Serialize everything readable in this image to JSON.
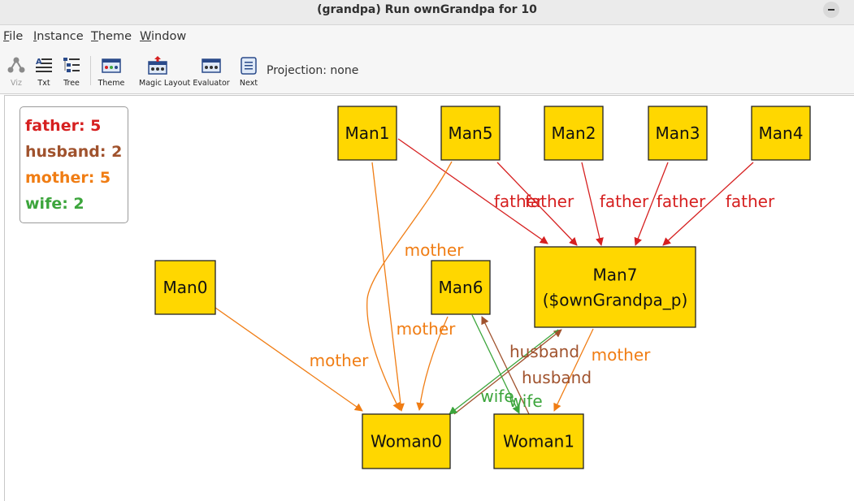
{
  "window": {
    "title": "(grandpa) Run ownGrandpa for 10"
  },
  "menu": [
    {
      "mnemonic": "F",
      "rest": "ile"
    },
    {
      "mnemonic": "I",
      "rest": "nstance"
    },
    {
      "mnemonic": "T",
      "rest": "heme"
    },
    {
      "mnemonic": "W",
      "rest": "indow"
    }
  ],
  "toolbar": {
    "viz": "Viz",
    "txt": "Txt",
    "tree": "Tree",
    "theme": "Theme",
    "magic_layout": "Magic Layout",
    "evaluator": "Evaluator",
    "next": "Next",
    "projection": "Projection: none"
  },
  "legend": [
    {
      "text": "father: 5",
      "color": "#d62020"
    },
    {
      "text": "husband: 2",
      "color": "#a0522d"
    },
    {
      "text": "mother: 5",
      "color": "#f07d14"
    },
    {
      "text": "wife: 2",
      "color": "#3ca53c"
    }
  ],
  "colors": {
    "node_fill": "#ffd700",
    "node_border": "#222222"
  },
  "graph": {
    "nodes": [
      {
        "id": "Man1",
        "label": "Man1"
      },
      {
        "id": "Man5",
        "label": "Man5"
      },
      {
        "id": "Man2",
        "label": "Man2"
      },
      {
        "id": "Man3",
        "label": "Man3"
      },
      {
        "id": "Man4",
        "label": "Man4"
      },
      {
        "id": "Man0",
        "label": "Man0"
      },
      {
        "id": "Man6",
        "label": "Man6"
      },
      {
        "id": "Man7",
        "label": "Man7",
        "sublabel": "($ownGrandpa_p)"
      },
      {
        "id": "Woman0",
        "label": "Woman0"
      },
      {
        "id": "Woman1",
        "label": "Woman1"
      }
    ],
    "edges": [
      {
        "from": "Man1",
        "to": "Man7",
        "label": "father",
        "relation": "father"
      },
      {
        "from": "Man5",
        "to": "Man7",
        "label": "father",
        "relation": "father"
      },
      {
        "from": "Man2",
        "to": "Man7",
        "label": "father",
        "relation": "father"
      },
      {
        "from": "Man3",
        "to": "Man7",
        "label": "father",
        "relation": "father"
      },
      {
        "from": "Man4",
        "to": "Man7",
        "label": "father",
        "relation": "father"
      },
      {
        "from": "Man1",
        "to": "Woman0",
        "label": "",
        "relation": "mother"
      },
      {
        "from": "Man5",
        "to": "Woman0",
        "label": "mother",
        "relation": "mother"
      },
      {
        "from": "Man0",
        "to": "Woman0",
        "label": "mother",
        "relation": "mother"
      },
      {
        "from": "Man6",
        "to": "Woman0",
        "label": "mother",
        "relation": "mother"
      },
      {
        "from": "Man7",
        "to": "Woman1",
        "label": "mother",
        "relation": "mother"
      },
      {
        "from": "Woman0",
        "to": "Man7",
        "label": "husband",
        "relation": "husband"
      },
      {
        "from": "Woman1",
        "to": "Man6",
        "label": "husband",
        "relation": "husband"
      },
      {
        "from": "Man7",
        "to": "Woman0",
        "label": "wife",
        "relation": "wife"
      },
      {
        "from": "Man6",
        "to": "Woman1",
        "label": "wife",
        "relation": "wife"
      }
    ]
  }
}
